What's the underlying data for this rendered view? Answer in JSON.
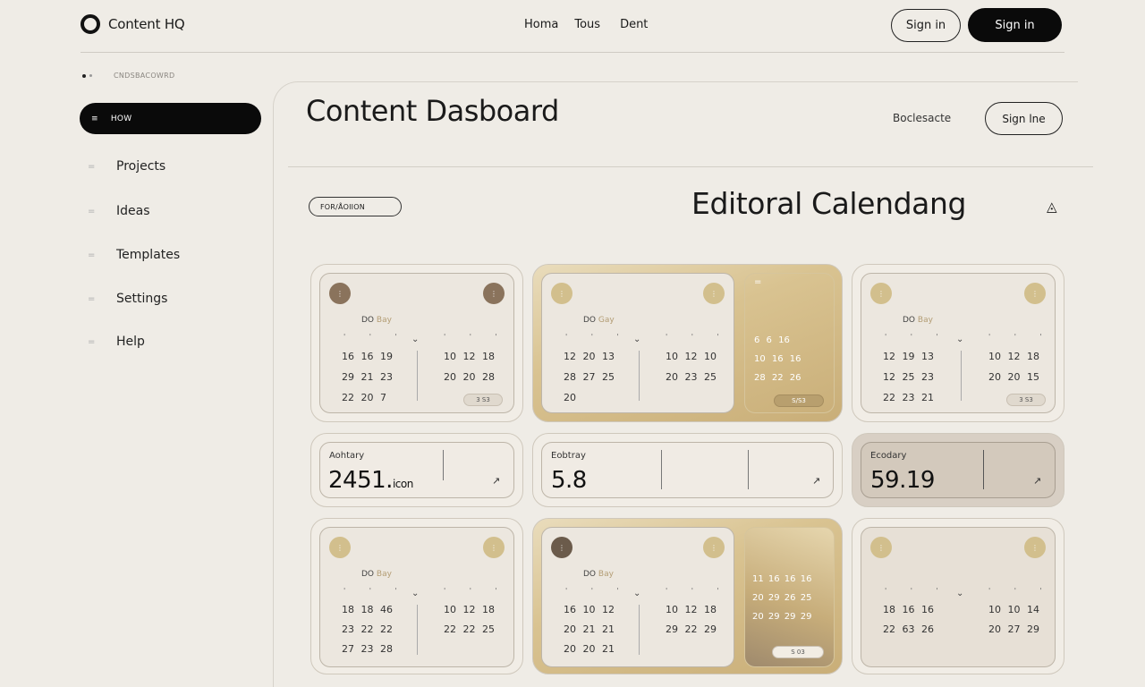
{
  "header": {
    "brand": "Content HQ",
    "nav": [
      "Homa",
      "Tous",
      "Dent"
    ],
    "sign_in_outline": "Sign in",
    "sign_in_solid": "Sign in"
  },
  "breadcrumb": "CNDSBACOWRD",
  "sidebar": {
    "active": "HOW",
    "items": [
      "Projects",
      "Ideas",
      "Templates",
      "Settings",
      "Help"
    ]
  },
  "main": {
    "title": "Content Dasboard",
    "browse_label": "Boclesacte",
    "sign_line": "Sign lne",
    "filter_label": "FOR/ÅOIION",
    "calendar_title": "Editoral Calendang"
  },
  "calendars": [
    {
      "head": "DO",
      "sub": "Bay",
      "rows_left": [
        "16 16 19",
        "29 21 23",
        "22 20 7"
      ],
      "rows_right": [
        "10 12 18",
        "20 20 28"
      ],
      "tag": "3 S3"
    },
    {
      "head": "DO",
      "sub": "Gay",
      "rows_left": [
        "12 20 13",
        "28 27 25",
        "20"
      ],
      "rows_right": [
        "10 12 10",
        "20 23 25"
      ],
      "gold_rows": [
        "6 6 16",
        "10 16 16",
        "28 22 26"
      ],
      "tag": "S/S3"
    },
    {
      "head": "DO",
      "sub": "Bay",
      "rows_left": [
        "12 19 13",
        "12 25 23",
        "22 23 21"
      ],
      "rows_right": [
        "10 12 18",
        "20 20 15"
      ],
      "tag": "3 S3"
    },
    {
      "head": "DO",
      "sub": "Bay",
      "rows_left": [
        "18 18 46",
        "23 22 22",
        "27 23 28"
      ],
      "rows_right": [
        "10 12 18",
        "22 22 25"
      ]
    },
    {
      "head": "DO",
      "sub": "Bay",
      "rows_left": [
        "16 10 12",
        "20 21 21",
        "20 20 21"
      ],
      "rows_right": [
        "10 12 18",
        "29 22 29"
      ],
      "gold_rows": [
        "11 16 16 16",
        "20 29 26 25",
        "20 29 29 29"
      ],
      "tag": "S 03"
    },
    {
      "head": "",
      "sub": "",
      "rows_left": [
        "18 16 16",
        "22 63 26"
      ],
      "rows_right": [
        "10 10 14",
        "20 27 29"
      ]
    }
  ],
  "stats": [
    {
      "label": "Aohtary",
      "value": "2451.",
      "suffix": "icon"
    },
    {
      "label": "Eobtray",
      "value": "5.8",
      "suffix": ""
    },
    {
      "label": "Ecodary",
      "value": "59.19",
      "suffix": ""
    }
  ]
}
